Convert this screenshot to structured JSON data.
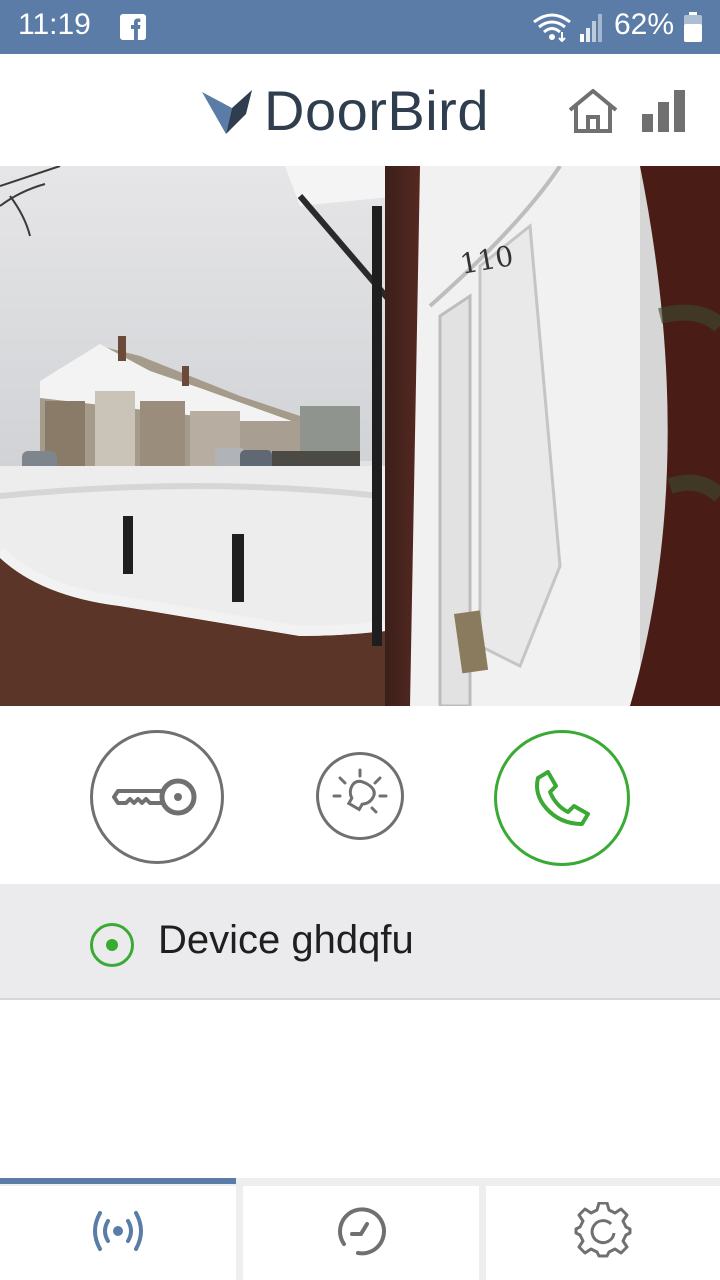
{
  "status_bar": {
    "time": "11:19",
    "battery": "62%",
    "icons": [
      "facebook-icon",
      "wifi-icon",
      "signal-icon",
      "battery-icon"
    ]
  },
  "header": {
    "logo_text": "DoorBird",
    "icons": [
      "home-icon",
      "signal-bars-icon"
    ]
  },
  "actions": {
    "buttons": [
      "key-icon",
      "light-icon",
      "phone-icon"
    ]
  },
  "device": {
    "name": "Device ghdqfu",
    "selected": true
  },
  "nav": {
    "tabs": [
      "live-icon",
      "history-icon",
      "settings-icon"
    ],
    "active_index": 0
  },
  "colors": {
    "accent": "#5b7ca6",
    "green": "#3aaa35",
    "grey_icon": "#707070",
    "logo": "#2f3e4e"
  }
}
